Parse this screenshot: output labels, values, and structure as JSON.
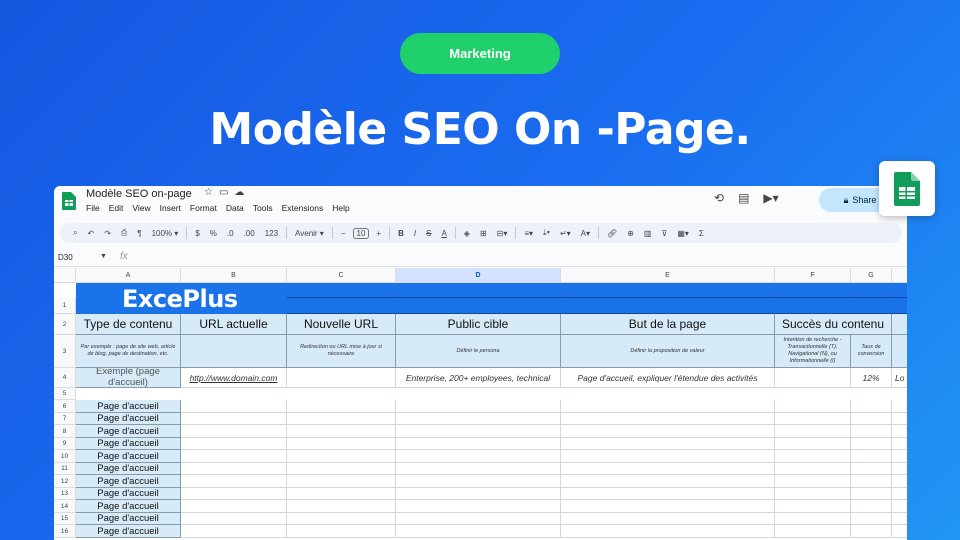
{
  "badge": "Marketing",
  "headline": "Modèle SEO On -Page.",
  "sheet": {
    "doc_title": "Modèle SEO on-page",
    "menus": [
      "File",
      "Edit",
      "View",
      "Insert",
      "Format",
      "Data",
      "Tools",
      "Extensions",
      "Help"
    ],
    "share_label": "Share",
    "toolbar": {
      "zoom": "100%",
      "currency": "$",
      "percent": "%",
      "dec_less": ".0",
      "dec_more": ".00",
      "format_123": "123",
      "font": "Avenir",
      "font_size": "10"
    },
    "name_box": "D30",
    "fx": "fx",
    "columns": [
      "A",
      "B",
      "C",
      "D",
      "E",
      "F",
      "G"
    ],
    "rows": [
      "1",
      "2",
      "3",
      "4",
      "5",
      "6",
      "7",
      "8",
      "9",
      "10",
      "11",
      "12",
      "13",
      "14",
      "15",
      "16"
    ],
    "logo_text": "ExcePlus",
    "headers": [
      "Type de contenu",
      "URL actuelle",
      "Nouvelle URL",
      "Public cible",
      "But de la page",
      "Succès du contenu"
    ],
    "subheaders": {
      "a": "Par exemple : page de site web, article de blog, page de destination, etc.",
      "c": "Redirection ou URL mise à jour si nécessaire",
      "d": "Définir le persona",
      "e": "Définir la proposition de valeur",
      "f": "Intention de recherche - Transactionnelle (T), Navigational (N), ou Informationnelle (I)",
      "g": "Taux de conversion"
    },
    "example_row": {
      "a": "Exemple (page d'accueil)",
      "b": "http://www.domain.com",
      "d": "Enterprise, 200+ employees, technical",
      "e": "Page d'accueil, expliquer l'étendue des activités",
      "g": "12%",
      "h": "Lo"
    },
    "home_label": "Page d'accueil"
  }
}
